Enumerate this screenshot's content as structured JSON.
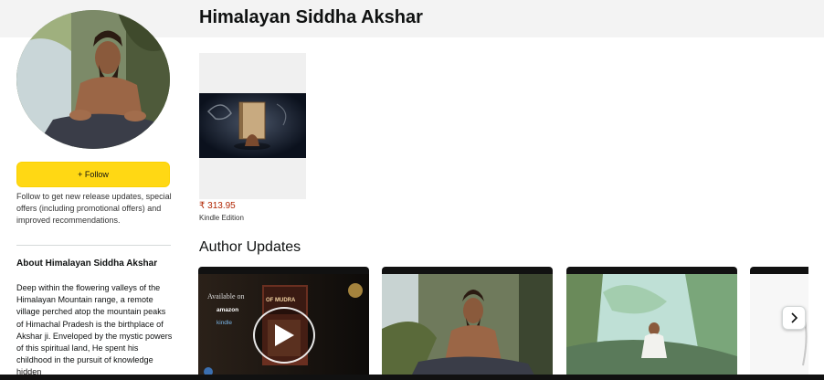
{
  "author": {
    "name": "Himalayan Siddha Akshar"
  },
  "follow": {
    "button_label": "+ Follow",
    "description": "Follow to get new release updates, special offers (including promotional offers) and improved recommendations."
  },
  "about": {
    "title": "About Himalayan Siddha Akshar",
    "text": "Deep within the flowering valleys of the Himalayan Mountain range, a remote village perched atop the mountain peaks of Himachal Pradesh is the birthplace of Akshar ji. Enveloped by the mystic powers of this spiritual land, He spent his childhood in the pursuit of knowledge hidden"
  },
  "books": [
    {
      "price": "₹ 313.95",
      "format": "Kindle Edition",
      "cover_text": "OF MUDRA"
    }
  ],
  "updates": {
    "title": "Author Updates",
    "video_card": {
      "available_on": "Available on",
      "store_1": "amazon",
      "store_2": "kindle",
      "book_text": "OF MUDRA"
    }
  },
  "colors": {
    "follow_button": "#ffd814",
    "price": "#b12704",
    "header_band": "#f3f3f3"
  },
  "icons": {
    "play": "play-icon",
    "next": "chevron-right-icon"
  }
}
